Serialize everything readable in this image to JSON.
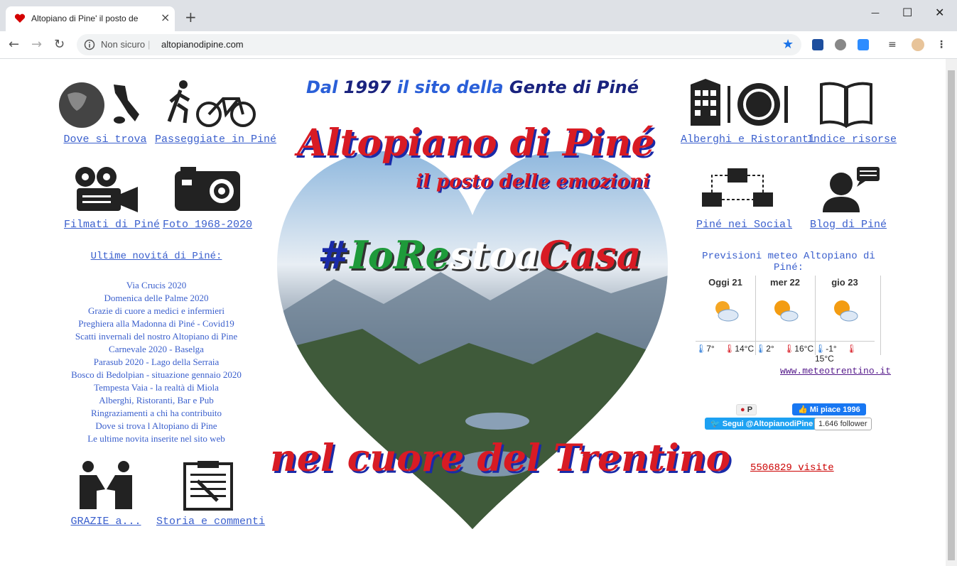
{
  "browser": {
    "tab_title": "Altopiano di Pine' il posto delle e",
    "tab_close": "×",
    "new_tab": "+",
    "win_min": "—",
    "win_max": "☐",
    "win_close": "✕",
    "security_label": "Non sicuro",
    "separator": "|",
    "url": "altopianodipine.com"
  },
  "left_links": {
    "dove": "Dove si trova",
    "passeggiate": "Passeggiate in Piné",
    "filmati": "Filmati di Piné",
    "foto": "Foto 1968-2020",
    "grazie": "GRAZIE a...",
    "storia": "Storia e commenti"
  },
  "news": {
    "title": "Ultime novitá di Piné:",
    "items": [
      "Via Crucis 2020",
      "Domenica delle Palme 2020",
      "Grazie di cuore a medici e infermieri",
      "Preghiera alla Madonna di Piné - Covid19",
      "Scatti invernali del nostro Altopiano di Pine",
      "Carnevale 2020 - Baselga",
      "Parasub 2020 - Lago della Serraia",
      "Bosco di Bedolpian - situazione gennaio 2020",
      "Tempesta Vaia - la realtà di Miola",
      "Alberghi, Ristoranti, Bar e Pub",
      "Ringraziamenti a chi ha contribuito",
      "Dove si trova l Altopiano di Pine",
      "Le ultime novita inserite nel sito web"
    ]
  },
  "center": {
    "headline_dal": "Dal",
    "headline_year": "1997",
    "headline_il_sito": "il sito della",
    "headline_gente": "Gente di Piné",
    "title": "Altopiano di Piné",
    "subtitle": "il posto delle emozioni",
    "hashtag_hash": "#",
    "hashtag_io": "Io",
    "hashtag_restoa": "Re",
    "hashtag_stoa": "stoa",
    "hashtag_casa": "Casa",
    "bottom": "nel cuore del Trentino"
  },
  "right_links": {
    "alberghi": "Alberghi e Ristoranti",
    "indice": "Indice risorse",
    "social": "Piné nei Social",
    "blog": "Blog di Piné"
  },
  "meteo": {
    "title": "Previsioni meteo Altopiano di Piné:",
    "days": [
      {
        "day": "Oggi 21",
        "min": "7°",
        "max": "14°C"
      },
      {
        "day": "mer 22",
        "min": "2°",
        "max": "16°C"
      },
      {
        "day": "gio 23",
        "min": "-1°",
        "max": "15°C"
      }
    ],
    "link": "www.meteotrentino.it"
  },
  "social": {
    "pinterest": "P",
    "facebook": "Mi piace 1996",
    "twitter": "Segui @AltopianodiPine",
    "followers": "1.646 follower"
  },
  "visits": "5506829 visite"
}
